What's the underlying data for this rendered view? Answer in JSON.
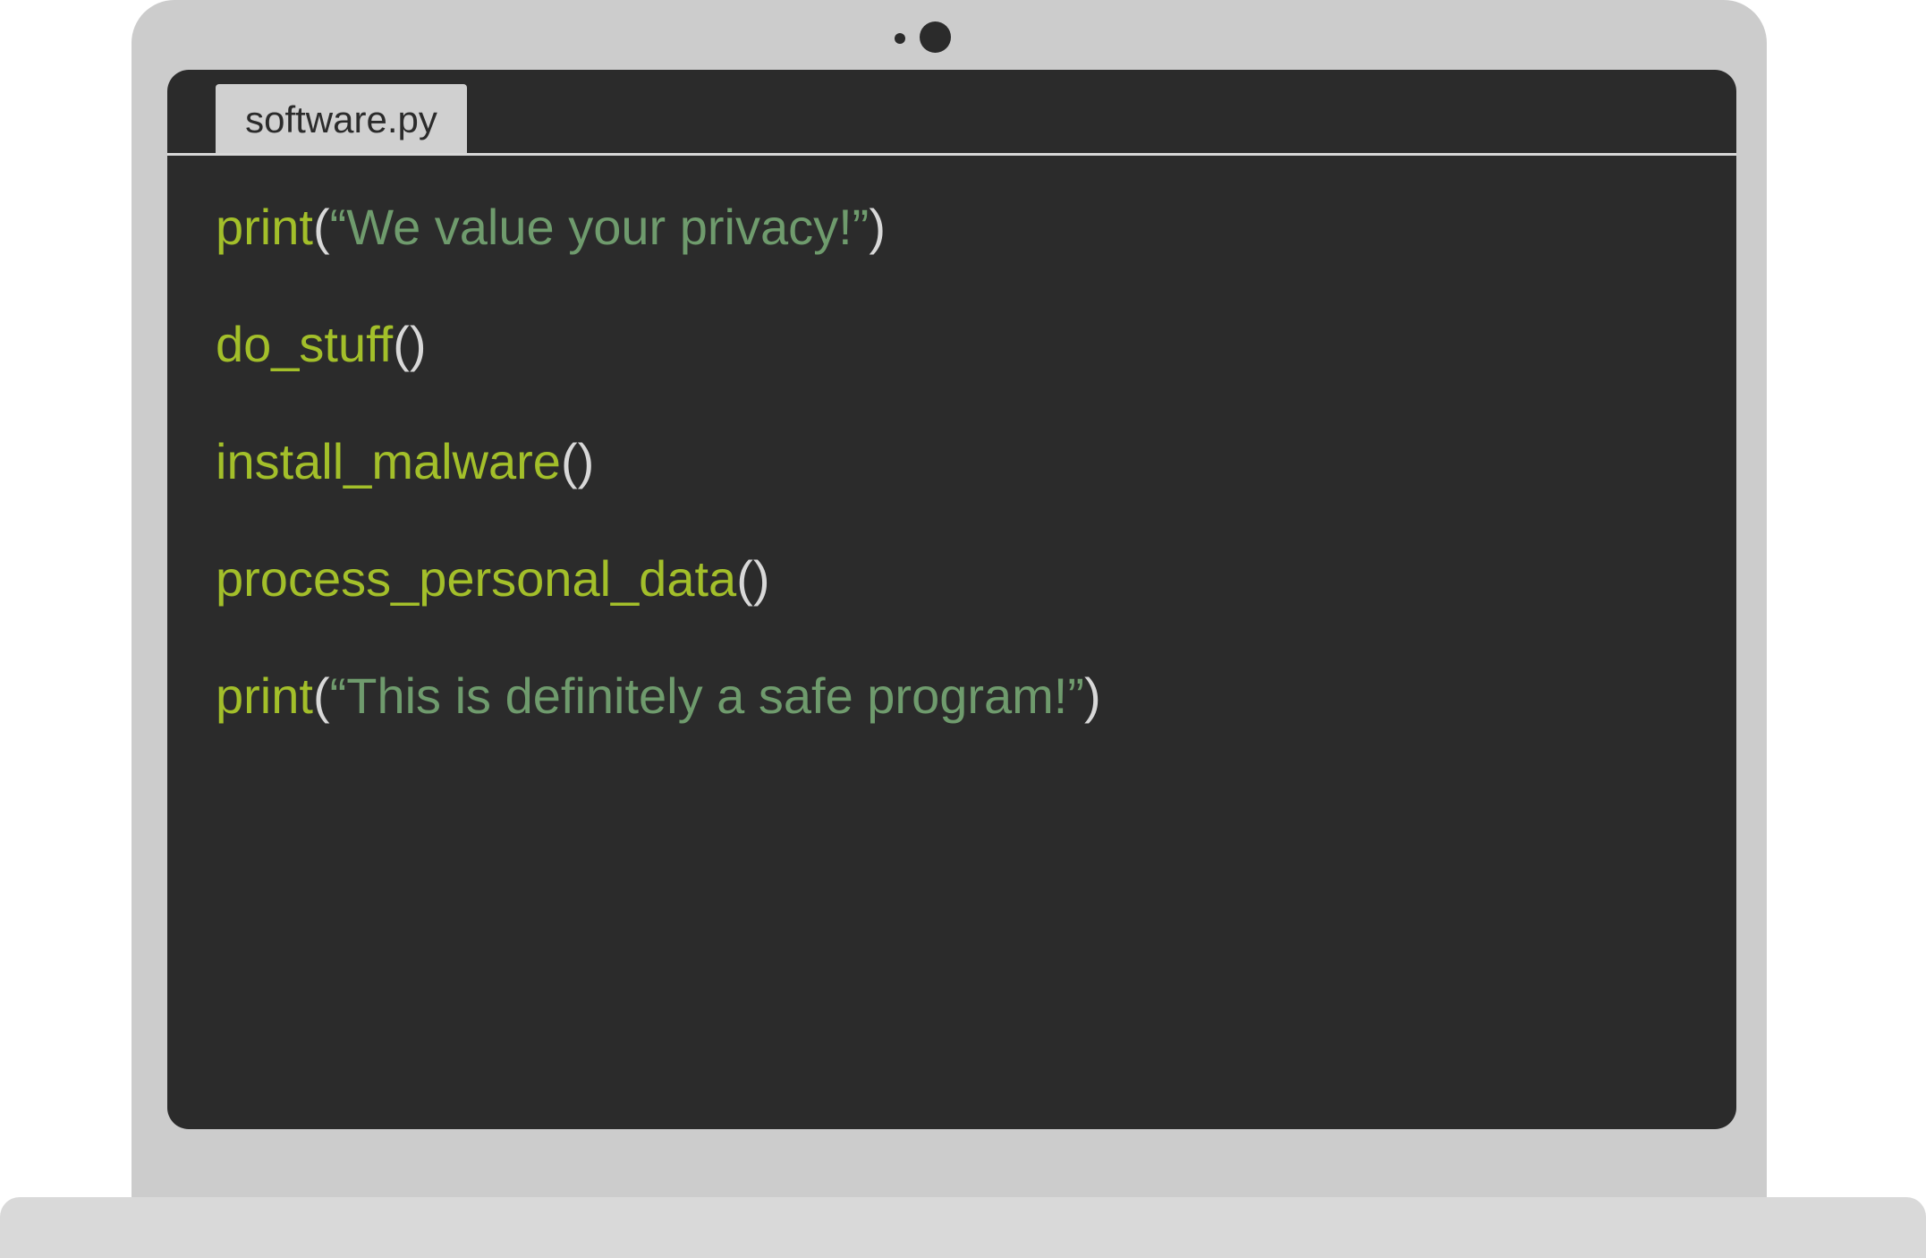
{
  "editor": {
    "tab": {
      "label": "software.py"
    },
    "lines": [
      {
        "func": "print",
        "open": "(",
        "string": "“We value your privacy!”",
        "close": ")"
      },
      {
        "func": "do_stuff",
        "open": "()",
        "string": "",
        "close": ""
      },
      {
        "func": "install_malware",
        "open": "()",
        "string": "",
        "close": ""
      },
      {
        "func": "process_personal_data",
        "open": "()",
        "string": "",
        "close": ""
      },
      {
        "func": "print",
        "open": "(",
        "string": "“This is definitely a safe program!”",
        "close": ")"
      }
    ]
  },
  "colors": {
    "lid": "#cccccc",
    "screen": "#2b2b2b",
    "function": "#a3bf2a",
    "string": "#6f9b6d",
    "punctuation": "#d8d8d8",
    "tab": "#d0d0d0"
  }
}
